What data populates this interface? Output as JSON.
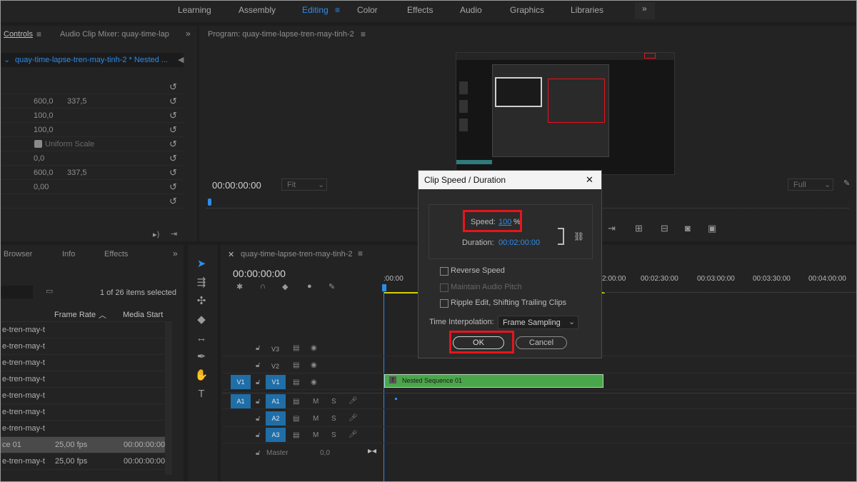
{
  "workspaces": [
    "Learning",
    "Assembly",
    "Editing",
    "Color",
    "Effects",
    "Audio",
    "Graphics",
    "Libraries"
  ],
  "workspace_active": "Editing",
  "more_glyph": "»",
  "source_panel": {
    "tabs": [
      "Controls",
      "Audio Clip Mixer: quay-time-lap"
    ],
    "clip_name": "quay-time-lapse-tren-may-tinh-2 * Nested ...",
    "rows": [
      {
        "v1": "",
        "v2": ""
      },
      {
        "v1": "600,0",
        "v2": "337,5"
      },
      {
        "v1": "100,0",
        "v2": ""
      },
      {
        "v1": "100,0",
        "v2": ""
      },
      {
        "v1": "Uniform Scale",
        "v2": ""
      },
      {
        "v1": "0,0",
        "v2": ""
      },
      {
        "v1": "600,0",
        "v2": "337,5"
      },
      {
        "v1": "0,00",
        "v2": ""
      },
      {
        "v1": "",
        "v2": ""
      }
    ]
  },
  "program_panel": {
    "title": "Program: quay-time-lapse-tren-may-tinh-2",
    "timecode": "00:00:00:00",
    "fit": "Fit",
    "quality": "Full"
  },
  "project_panel": {
    "tabs": [
      "Browser",
      "Info",
      "Effects"
    ],
    "items_selected": "1 of 26 items selected",
    "col_framerate": "Frame Rate",
    "col_mediastart": "Media Start",
    "rows": [
      {
        "name": "e-tren-may-t",
        "fps": "",
        "start": ""
      },
      {
        "name": "e-tren-may-t",
        "fps": "",
        "start": ""
      },
      {
        "name": "e-tren-may-t",
        "fps": "",
        "start": ""
      },
      {
        "name": "e-tren-may-t",
        "fps": "",
        "start": ""
      },
      {
        "name": "e-tren-may-t",
        "fps": "",
        "start": ""
      },
      {
        "name": "e-tren-may-t",
        "fps": "",
        "start": ""
      },
      {
        "name": "e-tren-may-t",
        "fps": "",
        "start": ""
      },
      {
        "name": "ce 01",
        "fps": "25,00 fps",
        "start": "00:00:00:00"
      },
      {
        "name": "e-tren-may-t",
        "fps": "25,00 fps",
        "start": "00:00:00:00"
      }
    ]
  },
  "timeline": {
    "tab": "quay-time-lapse-tren-may-tinh-2",
    "timecode": "00:00:00:00",
    "ruler": [
      ":00:00",
      "2:00:00",
      "00:02:30:00",
      "00:03:00:00",
      "00:03:30:00",
      "00:04:00:00"
    ],
    "tracks": [
      "V3",
      "V2",
      "V1",
      "A1",
      "A2",
      "A3"
    ],
    "src_v1": "V1",
    "src_a1": "A1",
    "m": "M",
    "s": "S",
    "master": "Master",
    "master_val": "0,0",
    "clip_name": "Nested Sequence 01"
  },
  "dialog": {
    "title": "Clip Speed / Duration",
    "close": "✕",
    "speed_label": "Speed:",
    "speed_value": "100",
    "speed_unit": "%",
    "duration_label": "Duration:",
    "duration_value": "00:02:00:00",
    "reverse_speed": "Reverse Speed",
    "maintain_pitch": "Maintain Audio Pitch",
    "ripple_edit": "Ripple Edit, Shifting Trailing Clips",
    "interp_label": "Time Interpolation:",
    "interp_value": "Frame Sampling",
    "ok": "OK",
    "cancel": "Cancel"
  },
  "colors": {
    "accent": "#2d8ceb",
    "highlight": "#e8141c",
    "clip": "#4aa64a",
    "track_badge": "#1f6ea8"
  }
}
